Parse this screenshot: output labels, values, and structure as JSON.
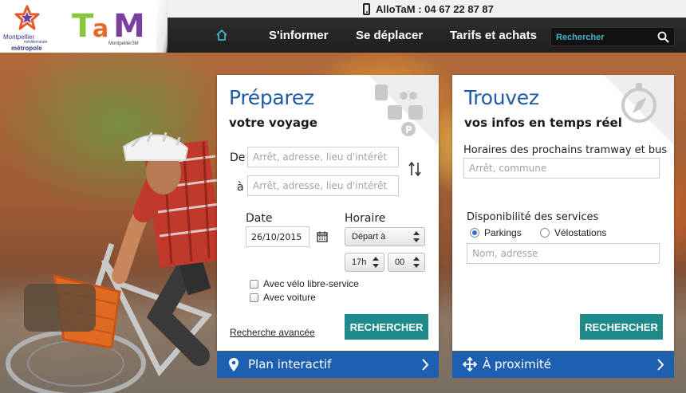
{
  "header": {
    "logo_metropole": {
      "line1": "Montpellier",
      "line2": "méditerranée",
      "line3": "métropole"
    },
    "logo_tam": {
      "wordmark": "TaM",
      "subtitle": "Montpellier3M"
    },
    "phone_text": "AlloTaM : 04 67 22 87 87",
    "nav": [
      {
        "label": "S'informer"
      },
      {
        "label": "Se déplacer"
      },
      {
        "label": "Tarifs et achats"
      }
    ],
    "search_placeholder": "Rechercher",
    "colors": {
      "accent": "#3fb7c7",
      "nav_bg": "#222222"
    }
  },
  "journey": {
    "title": "Préparez",
    "subtitle": "votre voyage",
    "from_label": "De",
    "to_label": "à",
    "from_placeholder": "Arrêt, adresse, lieu d'intérêt",
    "to_placeholder": "Arrêt, adresse, lieu d'intérêt",
    "date_label": "Date",
    "date_value": "26/10/2015",
    "time_label": "Horaire",
    "time_mode": "Départ à",
    "hour": "17h",
    "minute": "00",
    "option_bike": "Avec vélo libre-service",
    "option_car": "Avec voiture",
    "advanced_link": "Recherche avancée",
    "search_button": "RECHERCHER",
    "bottom_link": "Plan interactif"
  },
  "realtime": {
    "title": "Trouvez",
    "subtitle": "vos infos en temps réel",
    "schedules_label": "Horaires des prochains tramway et bus",
    "schedules_placeholder": "Arrêt, commune",
    "services_label": "Disponibilité des services",
    "radio_parkings": "Parkings",
    "radio_velostations": "Vélostations",
    "services_placeholder": "Nom, adresse",
    "selected_service": "Parkings",
    "search_button": "RECHERCHER",
    "bottom_link": "À proximité"
  },
  "colors": {
    "title_blue": "#1f5aa6",
    "button_teal": "#1e8a8a",
    "bar_blue": "#1d5fb0"
  }
}
